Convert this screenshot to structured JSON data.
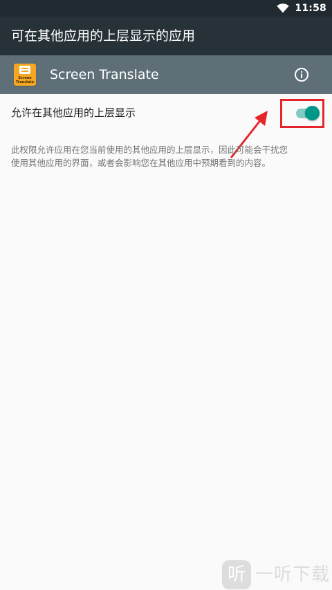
{
  "status_bar": {
    "time": "11:58",
    "wifi_icon": "wifi-icon",
    "background": "#212a30"
  },
  "app_bar": {
    "title": "可在其他应用的上层显示的应用",
    "background": "#263238"
  },
  "app_header": {
    "app_name": "Screen Translate",
    "icon_text": "Screen Translate",
    "icon": "screen-translate-app-icon",
    "info_icon": "info-icon",
    "background": "#5e6f78"
  },
  "permission": {
    "label": "允许在其他应用的上层显示",
    "toggle_on": true,
    "description_line1": "此权限允许应用在您当前使用的其他应用的上层显示，因此可能会干扰您",
    "description_line2": "使用其他应用的界面，或者会影响您在其他应用中预期看到的内容。",
    "accent": "#009688"
  },
  "annotation": {
    "highlight_color": "#e4262b",
    "arrow_color": "#e4262b"
  },
  "watermark": {
    "icon_char": "听",
    "text": "一听下载"
  }
}
